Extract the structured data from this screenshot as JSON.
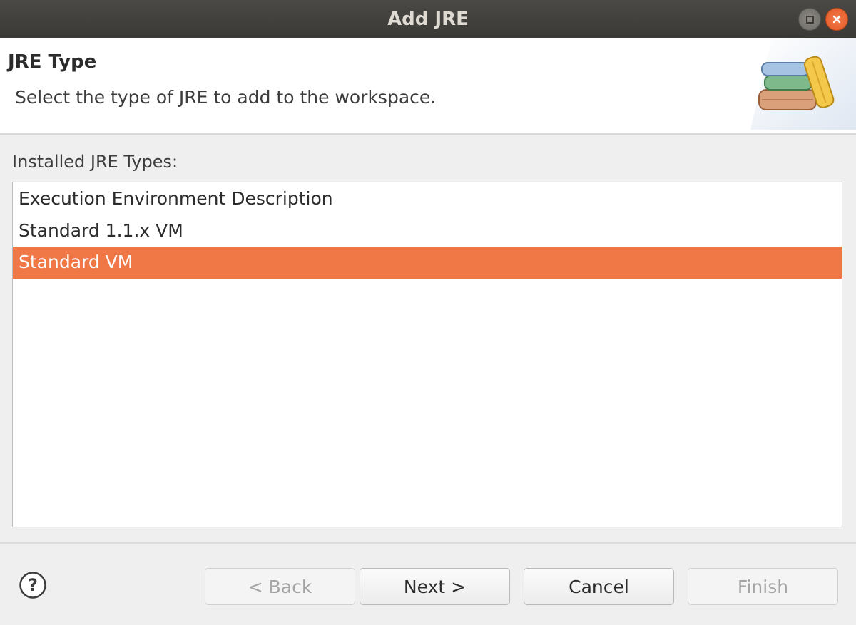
{
  "window": {
    "title": "Add JRE"
  },
  "header": {
    "title": "JRE Type",
    "description": "Select the type of JRE to add to the workspace."
  },
  "list": {
    "label": "Installed JRE Types:",
    "items": [
      {
        "label": "Execution Environment Description",
        "selected": false
      },
      {
        "label": "Standard 1.1.x VM",
        "selected": false
      },
      {
        "label": "Standard VM",
        "selected": true
      }
    ]
  },
  "buttons": {
    "back": "< Back",
    "next": "Next >",
    "cancel": "Cancel",
    "finish": "Finish"
  },
  "icons": {
    "help": "help-icon",
    "banner": "books-icon",
    "maximize": "maximize-icon",
    "close": "close-icon"
  },
  "colors": {
    "selection": "#f07746",
    "titlebar": "#3e3d39",
    "close_button": "#e85d28"
  }
}
